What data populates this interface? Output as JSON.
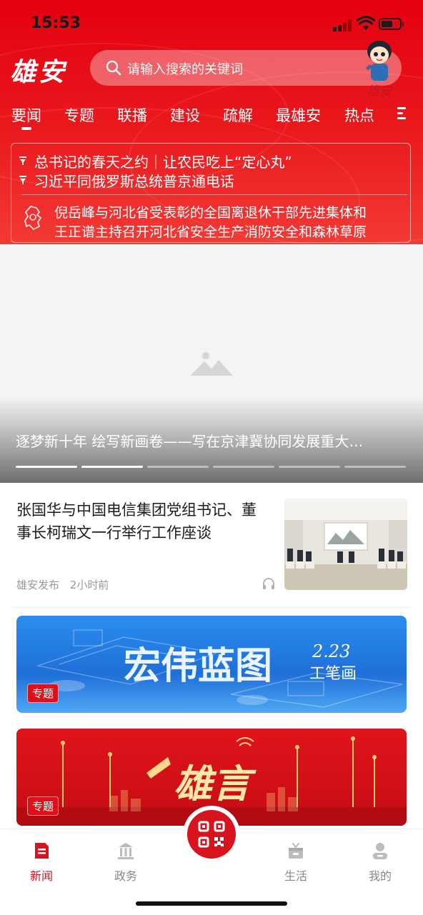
{
  "status": {
    "time": "15:53"
  },
  "header": {
    "logo": "雄安",
    "search_placeholder": "请输入搜索的关键词",
    "mascot_caption": "雄安"
  },
  "tabs": [
    "要闻",
    "专题",
    "联播",
    "建设",
    "疏解",
    "最雄安",
    "热点"
  ],
  "headlines": [
    "总书记的春天之约｜让农民吃上“定心丸”",
    "习近平同俄罗斯总统普京通电话"
  ],
  "province_news": [
    "倪岳峰与河北省受表彰的全国离退休干部先进集体和",
    "王正谱主持召开河北省安全生产消防安全和森林草原"
  ],
  "banner": {
    "title": "逐梦新十年 绘写新画卷——写在京津冀协同发展重大…",
    "slide_count": 6,
    "active_slides": [
      0,
      1
    ]
  },
  "article": {
    "title": "张国华与中国电信集团党组书记、董事长柯瑞文一行举行工作座谈",
    "source": "雄安发布",
    "time": "2小时前"
  },
  "cards": [
    {
      "title": "宏伟蓝图",
      "subtitle": "工笔画",
      "date": "2.23",
      "tag": "专题"
    },
    {
      "title": "雄言",
      "tag": "专题"
    }
  ],
  "tabbar": [
    {
      "label": "新闻",
      "icon": "news-icon",
      "active": true
    },
    {
      "label": "政务",
      "icon": "government-icon",
      "active": false
    },
    {
      "label": "生活",
      "icon": "life-icon",
      "active": false
    },
    {
      "label": "我的",
      "icon": "profile-icon",
      "active": false
    }
  ],
  "colors": {
    "brand_red": "#e4000f",
    "active_tab": "#d7141e"
  }
}
